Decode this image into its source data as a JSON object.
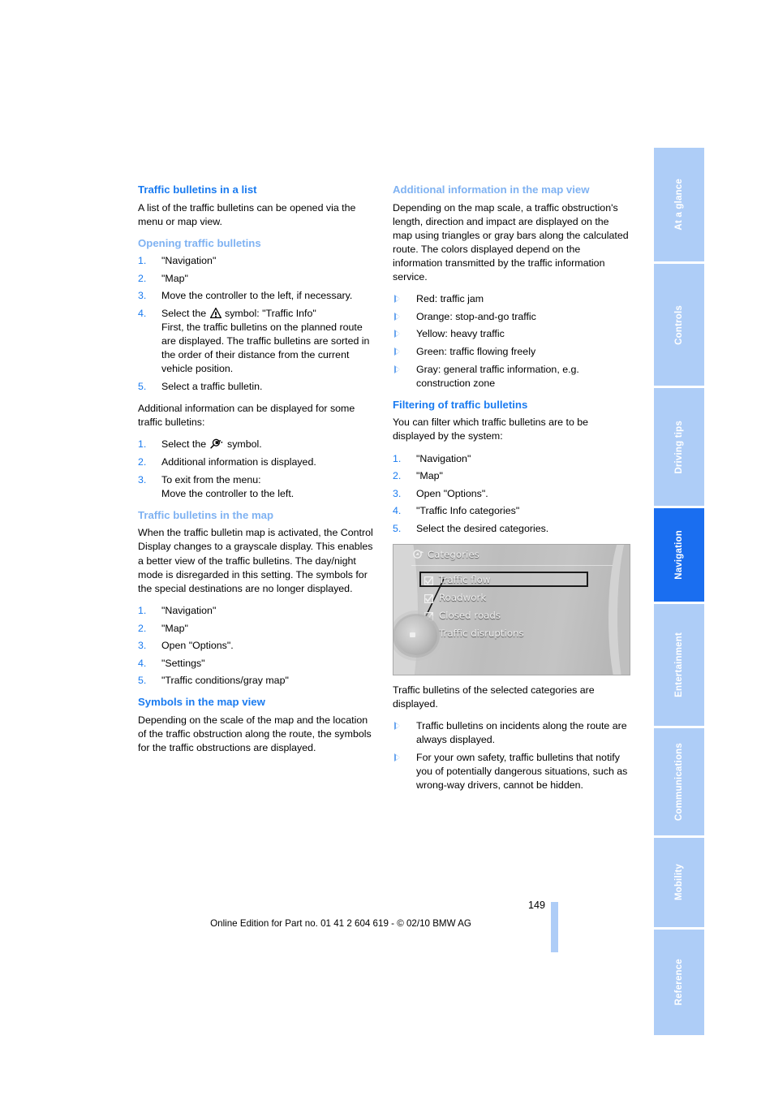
{
  "page": {
    "number": "149",
    "footer_note": "Online Edition for Part no. 01 41 2 604 619 - © 02/10 BMW AG"
  },
  "tabs": [
    {
      "label": "At a glance",
      "active": false
    },
    {
      "label": "Controls",
      "active": false
    },
    {
      "label": "Driving tips",
      "active": false
    },
    {
      "label": "Navigation",
      "active": true
    },
    {
      "label": "Entertainment",
      "active": false
    },
    {
      "label": "Communications",
      "active": false
    },
    {
      "label": "Mobility",
      "active": false
    },
    {
      "label": "Reference",
      "active": false
    }
  ],
  "left_column": {
    "section1": {
      "heading": "Traffic bulletins in a list",
      "intro": "A list of the traffic bulletins can be opened via the menu or map view."
    },
    "section2": {
      "heading": "Opening traffic bulletins",
      "steps": [
        {
          "num": "1.",
          "text": "\"Navigation\""
        },
        {
          "num": "2.",
          "text": "\"Map\""
        },
        {
          "num": "3.",
          "text": "Move the controller to the left, if necessary."
        },
        {
          "num": "4.",
          "text_before_icon": "Select the ",
          "icon": "warning-triangle-icon",
          "text_after_icon": " symbol: \"Traffic Info\"",
          "sub": "First, the traffic bulletins on the planned route are displayed. The traffic bulletins are sorted in the order of their distance from the current vehicle position."
        },
        {
          "num": "5.",
          "text": "Select a traffic bulletin."
        }
      ],
      "after_steps": "Additional information can be displayed for some traffic bulletins:",
      "steps2": [
        {
          "num": "1.",
          "text_before_icon": "Select the ",
          "icon": "magnifier-icon",
          "text_after_icon": " symbol."
        },
        {
          "num": "2.",
          "text": "Additional information is displayed."
        },
        {
          "num": "3.",
          "text": "To exit from the menu:",
          "sub": "Move the controller to the left."
        }
      ]
    },
    "section3": {
      "heading": "Traffic bulletins in the map",
      "intro": "When the traffic bulletin map is activated, the Control Display changes to a grayscale display. This enables a better view of the traffic bulletins. The day/night mode is disregarded in this setting. The symbols for the special destinations are no longer displayed.",
      "steps": [
        {
          "num": "1.",
          "text": "\"Navigation\""
        },
        {
          "num": "2.",
          "text": "\"Map\""
        },
        {
          "num": "3.",
          "text": "Open \"Options\"."
        },
        {
          "num": "4.",
          "text": "\"Settings\""
        },
        {
          "num": "5.",
          "text": "\"Traffic conditions/gray map\""
        }
      ]
    },
    "section4": {
      "heading": "Symbols in the map view",
      "intro": "Depending on the scale of the map and the location of the traffic obstruction along the route, the symbols for the traffic obstructions are displayed."
    }
  },
  "right_column": {
    "section1": {
      "heading": "Additional information in the map view",
      "intro": "Depending on the map scale, a traffic obstruction's length, direction and impact are displayed on the map using triangles or gray bars along the calculated route. The colors displayed depend on the information transmitted by the traffic information service.",
      "bullets": [
        "Red: traffic jam",
        "Orange: stop-and-go traffic",
        "Yellow: heavy traffic",
        "Green: traffic flowing freely",
        "Gray: general traffic information, e.g. construction zone"
      ]
    },
    "section2": {
      "heading": "Filtering of traffic bulletins",
      "intro": "You can filter which traffic bulletins are to be displayed by the system:",
      "steps": [
        {
          "num": "1.",
          "text": "\"Navigation\""
        },
        {
          "num": "2.",
          "text": "\"Map\""
        },
        {
          "num": "3.",
          "text": "Open \"Options\"."
        },
        {
          "num": "4.",
          "text": "\"Traffic Info categories\""
        },
        {
          "num": "5.",
          "text": "Select the desired categories."
        }
      ],
      "screenshot": {
        "title": "Categories",
        "items": [
          {
            "label": "Traffic flow",
            "checked": true,
            "highlighted": true
          },
          {
            "label": "Roadwork",
            "checked": true,
            "highlighted": false
          },
          {
            "label": "Closed roads",
            "checked": true,
            "highlighted": false
          },
          {
            "label": "Traffic disruptions",
            "checked": true,
            "highlighted": false
          }
        ]
      },
      "after_image": "Traffic bulletins of the selected categories are displayed.",
      "bullets": [
        "Traffic bulletins on incidents along the route are always displayed.",
        "For your own safety, traffic bulletins that notify you of potentially dangerous situations, such as wrong-way drivers, cannot be hidden."
      ]
    }
  },
  "colors": {
    "heading_main": "#1a7bf0",
    "heading_sub": "#7fb2f2",
    "tab_inactive": "#aecdf7",
    "tab_active": "#1a6ef0",
    "number_marker": "#1a7bf0",
    "bullet_triangle": "#6aa6ef"
  }
}
